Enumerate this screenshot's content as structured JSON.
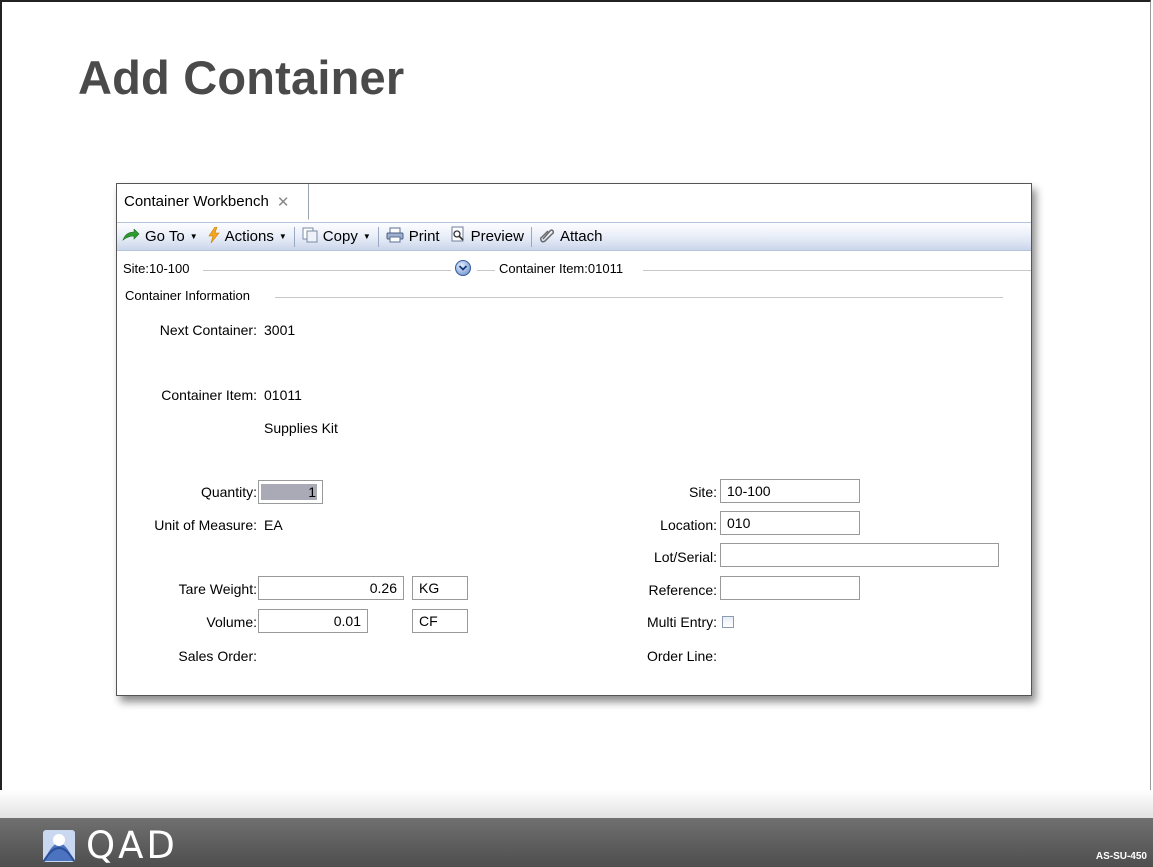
{
  "slide": {
    "title": "Add Container",
    "footer_logo": "QAD",
    "course_code": "AS-SU-450"
  },
  "window": {
    "tab": {
      "label": "Container Workbench",
      "close_icon": "close-icon"
    },
    "toolbar": {
      "goto": {
        "label": "Go To",
        "icon": "goto-arrow-icon"
      },
      "actions": {
        "label": "Actions",
        "icon": "lightning-icon"
      },
      "copy": {
        "label": "Copy",
        "icon": "copy-icon"
      },
      "print": {
        "label": "Print",
        "icon": "printer-icon"
      },
      "preview": {
        "label": "Preview",
        "icon": "preview-icon"
      },
      "attach": {
        "label": "Attach",
        "icon": "paperclip-icon"
      }
    },
    "header": {
      "site": "Site:10-100",
      "container_item": "Container Item:01011"
    },
    "section_title": "Container Information",
    "form": {
      "next_container_label": "Next Container:",
      "next_container_value": "3001",
      "container_item_label": "Container Item:",
      "container_item_value": "01011",
      "container_item_desc": "Supplies Kit",
      "quantity_label": "Quantity:",
      "quantity_value": "1",
      "uom_label": "Unit of Measure:",
      "uom_value": "EA",
      "tare_weight_label": "Tare Weight:",
      "tare_weight_value": "0.26",
      "tare_weight_unit": "KG",
      "volume_label": "Volume:",
      "volume_value": "0.01",
      "volume_unit": "CF",
      "sales_order_label": "Sales Order:",
      "site_label": "Site:",
      "site_value": "10-100",
      "location_label": "Location:",
      "location_value": "010",
      "lot_serial_label": "Lot/Serial:",
      "lot_serial_value": "",
      "reference_label": "Reference:",
      "reference_value": "",
      "multi_entry_label": "Multi Entry:",
      "multi_entry_checked": false,
      "order_line_label": "Order Line:"
    }
  },
  "colors": {
    "title": "#4a4a4a",
    "footer": "#5a5a5a",
    "toolbar_gradient_end": "#cbd6ea",
    "quantity_highlight": "#a9aab5"
  }
}
